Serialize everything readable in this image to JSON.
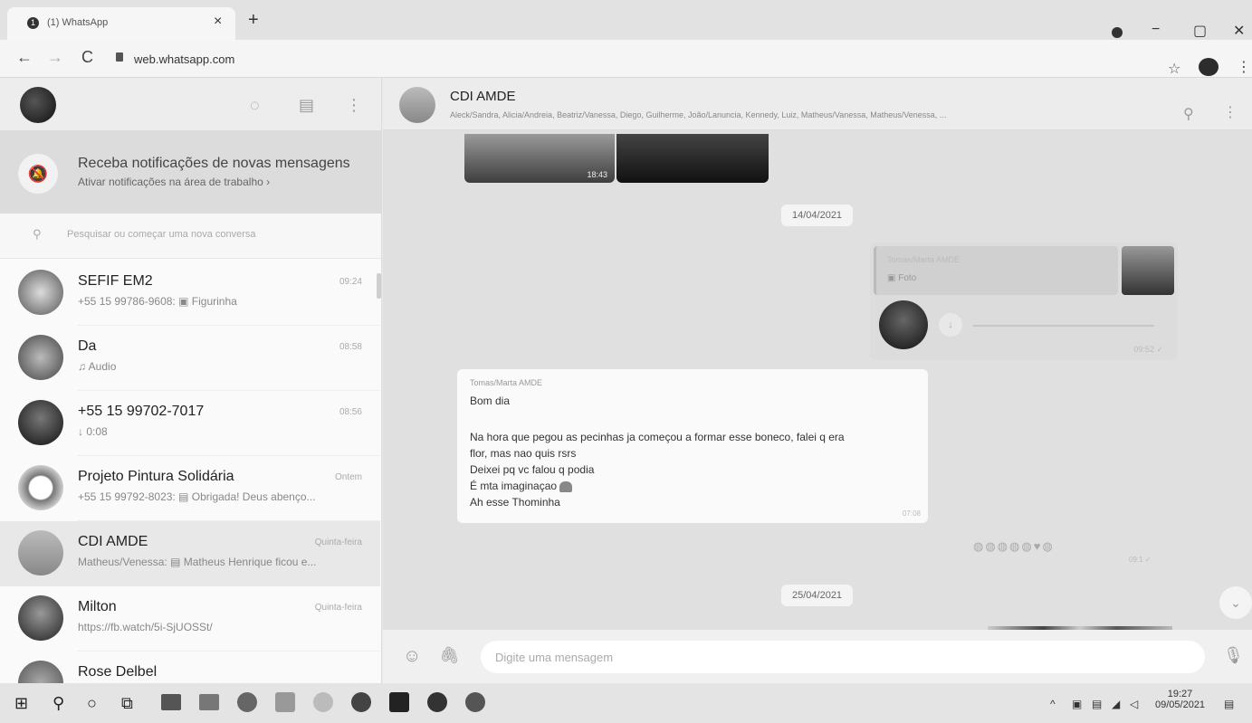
{
  "browser": {
    "tab_title": "(1) WhatsApp",
    "tab_close": "×",
    "new_tab": "+",
    "url": "web.whatsapp.com",
    "back": "←",
    "forward": "→",
    "reload": "C",
    "star": "☆",
    "menu": "⋮",
    "win_minimize": "−",
    "win_restore": "▢",
    "win_close": "✕"
  },
  "left_header": {
    "status_icon": "◌",
    "chat_icon": "▤",
    "menu_icon": "⋮"
  },
  "notification": {
    "title": "Receba notificações de novas mensagens",
    "subtitle": "Ativar notificações na área de trabalho ›",
    "icon": "🔕"
  },
  "search": {
    "icon": "⚲",
    "placeholder": "Pesquisar ou começar uma nova conversa"
  },
  "chats": [
    {
      "name": "SEFIF EM2",
      "time": "09:24",
      "preview": "+55 15 99786-9608: ▣ Figurinha"
    },
    {
      "name": "Da",
      "time": "08:58",
      "preview": "♫ Audio"
    },
    {
      "name": "+55 15 99702-7017",
      "time": "08:56",
      "preview": "↓ 0:08"
    },
    {
      "name": "Projeto Pintura Solidária",
      "time": "Ontem",
      "preview": "+55 15 99792-8023: ▤ Obrigada! Deus abenço..."
    },
    {
      "name": "CDI AMDE",
      "time": "Quinta-feira",
      "preview": "Matheus/Venessa: ▤ Matheus Henrique ficou e..."
    },
    {
      "name": "Milton",
      "time": "Quinta-feira",
      "preview": "https://fb.watch/5i-SjUOSSt/"
    },
    {
      "name": "Rose Delbel",
      "time": "",
      "preview": ""
    }
  ],
  "conversation": {
    "name": "CDI AMDE",
    "members": "Aleck/Sandra, Alicia/Andreia, Beatriz/Vanessa, Diego, Guilherme, João/Lanuncia, Kennedy, Luiz, Matheus/Vanessa, Matheus/Venessa, ...",
    "search_icon": "⚲",
    "menu_icon": "⋮",
    "image_time": "18:43",
    "date1": "14/04/2021",
    "reply_sender": "Tomas/Marta AMDE",
    "reply_type": "▣ Foto",
    "audio_time": "09:52 ✓",
    "audio_play": "↓",
    "msg_sender": "Tomas/Marta AMDE",
    "msg_lines": [
      "Bom dia",
      "Na hora que pegou as pecinhas ja começou a formar esse boneco, falei q era",
      "flor, mas nao quis rsrs",
      "Deixei pq vc falou q podia",
      "É mta imaginaçao",
      "Ah esse Thominha"
    ],
    "msg_time": "07:08",
    "emoji_row": "◍◍◍◍◍♥◍",
    "emoji_time": "09:1 ✓",
    "date2": "25/04/2021",
    "scroll_down": "⌄"
  },
  "composer": {
    "emoji_icon": "☺",
    "attach_icon": "🖇",
    "placeholder": "Digite uma mensagem",
    "mic_icon": "🎙"
  },
  "taskbar": {
    "start": "⊞",
    "search": "⚲",
    "cortana": "○",
    "taskview": "⧉",
    "tray_chevron": "^",
    "clock_time": "19:27",
    "clock_date": "09/05/2021",
    "notifications": "▤"
  },
  "colors": {
    "background": "#e0e0e0",
    "selected_chat": "#e8e8e8",
    "incoming_bubble": "#fafafa"
  }
}
